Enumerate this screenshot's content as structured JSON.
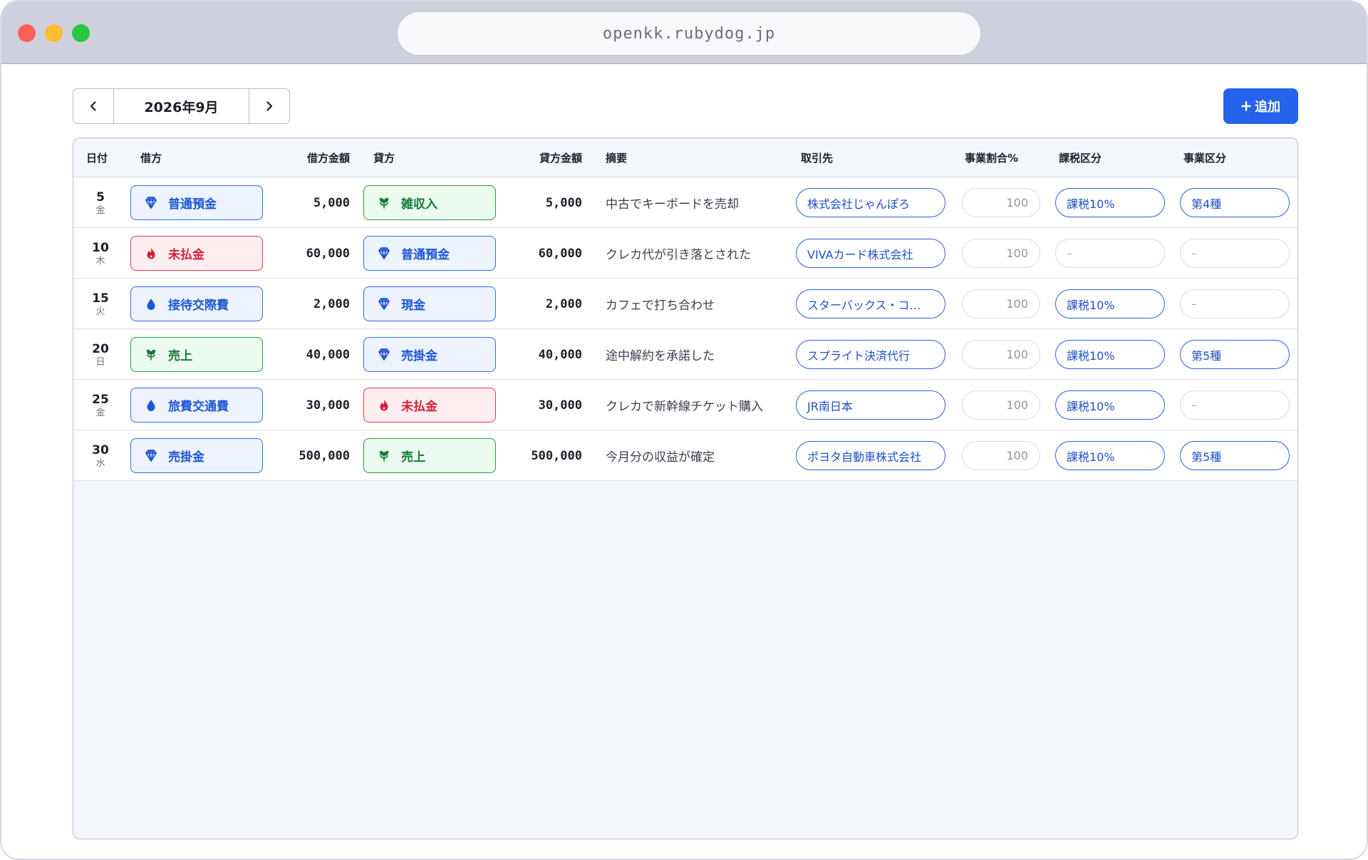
{
  "browser": {
    "url": "openkk.rubydog.jp"
  },
  "toolbar": {
    "prev_icon": "chevron-left-icon",
    "month": "2026年9月",
    "next_icon": "chevron-right-icon",
    "add_label": "追加",
    "add_icon": "plus-icon"
  },
  "table": {
    "headers": {
      "date": "日付",
      "debit": "借方",
      "debit_amount": "借方金額",
      "credit": "貸方",
      "credit_amount": "貸方金額",
      "memo": "摘要",
      "partner": "取引先",
      "ratio": "事業割合%",
      "tax": "課税区分",
      "business": "事業区分"
    },
    "rows": [
      {
        "day": "5",
        "weekday": "金",
        "debit": "普通預金",
        "debit_kind": "asset",
        "debit_amount": "5,000",
        "credit": "雑収入",
        "credit_kind": "revenue",
        "credit_amount": "5,000",
        "memo": "中古でキーボードを売却",
        "partner": "株式会社じゃんぽろ",
        "ratio": "100",
        "tax": "課税10%",
        "business": "第4種"
      },
      {
        "day": "10",
        "weekday": "木",
        "debit": "未払金",
        "debit_kind": "liability",
        "debit_amount": "60,000",
        "credit": "普通預金",
        "credit_kind": "asset",
        "credit_amount": "60,000",
        "memo": "クレカ代が引き落とされた",
        "partner": "VIVAカード株式会社",
        "ratio": "100",
        "tax": "–",
        "business": "–"
      },
      {
        "day": "15",
        "weekday": "火",
        "debit": "接待交際費",
        "debit_kind": "expense",
        "debit_amount": "2,000",
        "credit": "現金",
        "credit_kind": "asset",
        "credit_amount": "2,000",
        "memo": "カフェで打ち合わせ",
        "partner": "スターバックス・コ…",
        "ratio": "100",
        "tax": "課税10%",
        "business": "–"
      },
      {
        "day": "20",
        "weekday": "日",
        "debit": "売上",
        "debit_kind": "revenue",
        "debit_amount": "40,000",
        "credit": "売掛金",
        "credit_kind": "asset",
        "credit_amount": "40,000",
        "memo": "途中解約を承諾した",
        "partner": "スプライト決済代行",
        "ratio": "100",
        "tax": "課税10%",
        "business": "第5種"
      },
      {
        "day": "25",
        "weekday": "金",
        "debit": "旅費交通費",
        "debit_kind": "expense",
        "debit_amount": "30,000",
        "credit": "未払金",
        "credit_kind": "liability",
        "credit_amount": "30,000",
        "memo": "クレカで新幹線チケット購入",
        "partner": "JR南日本",
        "ratio": "100",
        "tax": "課税10%",
        "business": "–"
      },
      {
        "day": "30",
        "weekday": "水",
        "debit": "売掛金",
        "debit_kind": "asset",
        "debit_amount": "500,000",
        "credit": "売上",
        "credit_kind": "revenue",
        "credit_amount": "500,000",
        "memo": "今月分の収益が確定",
        "partner": "ポヨタ自動車株式会社",
        "ratio": "100",
        "tax": "課税10%",
        "business": "第5種"
      }
    ]
  },
  "account_styles": {
    "asset": {
      "icon": "diamond-icon",
      "color": "#1d56d6"
    },
    "liability": {
      "icon": "flame-icon",
      "color": "#d21f3c"
    },
    "expense": {
      "icon": "droplet-icon",
      "color": "#1d56d6"
    },
    "revenue": {
      "icon": "sprout-icon",
      "color": "#167a36"
    }
  }
}
